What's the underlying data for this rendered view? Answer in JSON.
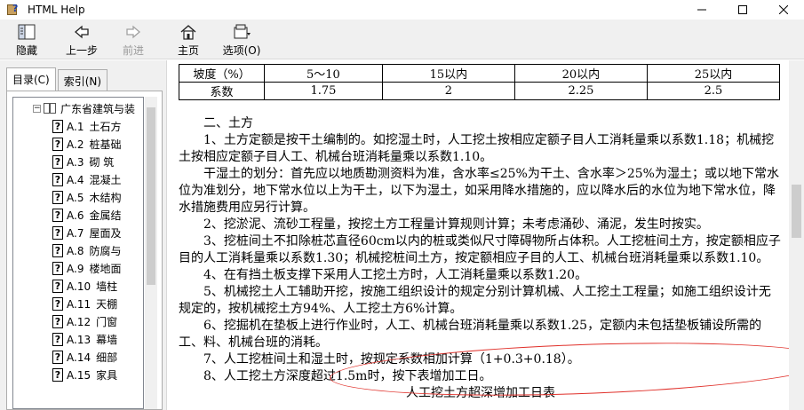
{
  "window": {
    "title": "HTML Help",
    "minimize": "—",
    "maximize": "☐",
    "close": "✕"
  },
  "toolbar": {
    "hide_label": "隐藏",
    "back_label": "上一步",
    "forward_label": "前进",
    "home_label": "主页",
    "options_label": "选项(O)"
  },
  "tabs": {
    "contents": "目录(C)",
    "index": "索引(N)"
  },
  "tree": {
    "root": "广东省建筑与装",
    "items": [
      {
        "code": "A.1",
        "label": "土石方"
      },
      {
        "code": "A.2",
        "label": "桩基础"
      },
      {
        "code": "A.3",
        "label": "砌  筑"
      },
      {
        "code": "A.4",
        "label": "混凝土"
      },
      {
        "code": "A.5",
        "label": "木结构"
      },
      {
        "code": "A.6",
        "label": "金属结"
      },
      {
        "code": "A.7",
        "label": "屋面及"
      },
      {
        "code": "A.8",
        "label": "防腐与"
      },
      {
        "code": "A.9",
        "label": "楼地面"
      },
      {
        "code": "A.10",
        "label": "墙柱"
      },
      {
        "code": "A.11",
        "label": "天棚"
      },
      {
        "code": "A.12",
        "label": "门窗"
      },
      {
        "code": "A.13",
        "label": "幕墙"
      },
      {
        "code": "A.14",
        "label": "细部"
      },
      {
        "code": "A.15",
        "label": "家具"
      }
    ]
  },
  "table": {
    "header": [
      "坡度（%）",
      "5～10",
      "15以内",
      "20以内",
      "25以内"
    ],
    "row": [
      "系数",
      "1.75",
      "2",
      "2.25",
      "2.5"
    ]
  },
  "doc": {
    "section_title": "二、土方",
    "p1": "1、土方定额是按干土编制的。如挖湿土时，人工挖土按相应定额子目人工消耗量乘以系数1.18；机械挖土按相应定额子目人工、机械台班消耗量乘以系数1.10。",
    "p2": "干湿土的划分：首先应以地质勘测资料为准，含水率≤25%为干土、含水率＞25%为湿土；或以地下常水位为准划分，地下常水位以上为干土，以下为湿土，如采用降水措施的，应以降水后的水位为地下常水位，降水措施费用应另行计算。",
    "p3": "2、挖淤泥、流砂工程量，按挖土方工程量计算规则计算；未考虑涌砂、涌泥，发生时按实。",
    "p4": "3、挖桩间土不扣除桩芯直径60cm以内的桩或类似尺寸障碍物所占体积。人工挖桩间土方，按定额相应子目的人工消耗量乘以系数1.30；机械挖桩间土方，按定额相应子目的人工、机械台班消耗量乘以系数1.10。",
    "p5": "4、在有挡土板支撑下采用人工挖土方时，人工消耗量乘以系数1.20。",
    "p6": "5、机械挖土人工辅助开挖，按施工组织设计的规定分别计算机械、人工挖土工程量；如施工组织设计无规定的，按机械挖土方94%、人工挖土方6%计算。",
    "p7": "6、挖掘机在垫板上进行作业时，人工、机械台班消耗量乘以系数1.25，定额内未包括垫板铺设所需的工、料、机械台班的消耗。",
    "p8": "7、人工挖桩间土和湿土时，按规定系数相加计算（1+0.3+0.18）。",
    "p9": "8、人工挖土方深度超过1.5m时，按下表增加工日。",
    "p10": "人工挖土方超深增加工日表"
  },
  "colors": {
    "annotation": "#e0302a",
    "chrome": "#f0f0f0"
  }
}
